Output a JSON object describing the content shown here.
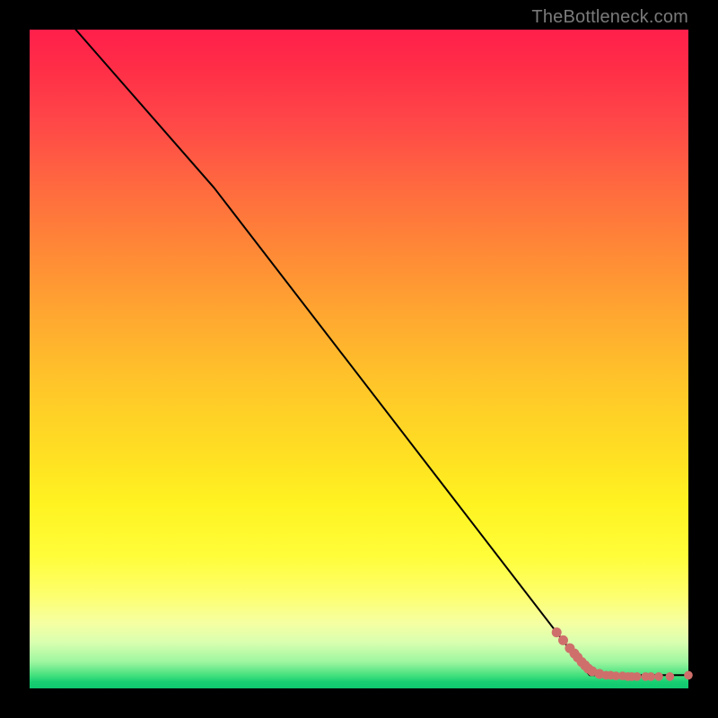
{
  "watermark": "TheBottleneck.com",
  "colors": {
    "frame": "#000000",
    "watermark": "#7a7a7a",
    "curve": "#000000",
    "dot": "#cf6f6b",
    "gradient_top": "#ff1f4b",
    "gradient_bottom": "#0fc76e"
  },
  "chart_data": {
    "type": "line",
    "title": "",
    "xlabel": "",
    "ylabel": "",
    "xlim": [
      0,
      100
    ],
    "ylim": [
      0,
      100
    ],
    "grid": false,
    "legend": false,
    "series": [
      {
        "name": "curve",
        "kind": "line",
        "x": [
          7,
          28,
          85,
          100
        ],
        "y": [
          100,
          76,
          2,
          2
        ]
      },
      {
        "name": "points",
        "kind": "scatter",
        "x": [
          80,
          81,
          82,
          82.7,
          83.2,
          83.8,
          84.3,
          84.8,
          85.4,
          86.5,
          87.5,
          88.2,
          89,
          90,
          90.8,
          91.4,
          92.2,
          93.5,
          94.3,
          95.5,
          97.2,
          100
        ],
        "y": [
          8.5,
          7.3,
          6.1,
          5.3,
          4.7,
          4.0,
          3.5,
          3.0,
          2.6,
          2.2,
          2.0,
          2.0,
          1.9,
          1.9,
          1.8,
          1.8,
          1.8,
          1.8,
          1.8,
          1.8,
          1.8,
          2.0
        ]
      }
    ]
  }
}
